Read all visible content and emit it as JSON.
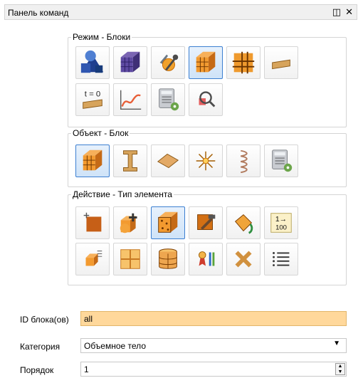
{
  "panel": {
    "title": "Панель команд",
    "float_icon": "float-icon",
    "close_icon": "close-icon"
  },
  "groups": {
    "mode": {
      "title": "Режим - Блоки",
      "buttons": [
        {
          "icon": "geometry-shapes-icon",
          "active": false
        },
        {
          "icon": "mesh-block-icon",
          "active": false
        },
        {
          "icon": "block-tools-icon",
          "active": false
        },
        {
          "icon": "orange-block-icon",
          "active": true
        },
        {
          "icon": "cross-grid-icon",
          "active": false
        },
        {
          "icon": "beam-section-icon",
          "active": false
        },
        {
          "icon": "initial-time-icon",
          "active": false,
          "label": "t = 0"
        },
        {
          "icon": "curve-graph-icon",
          "active": false
        },
        {
          "icon": "calculator-settings-icon",
          "active": false
        },
        {
          "icon": "search-inspect-icon",
          "active": false
        }
      ]
    },
    "object": {
      "title": "Объект - Блок",
      "buttons": [
        {
          "icon": "orange-block-icon",
          "active": true
        },
        {
          "icon": "i-beam-icon",
          "active": false
        },
        {
          "icon": "shell-plate-icon",
          "active": false
        },
        {
          "icon": "point-star-icon",
          "active": false
        },
        {
          "icon": "spring-icon",
          "active": false
        },
        {
          "icon": "calculator-settings-icon",
          "active": false
        }
      ]
    },
    "action": {
      "title": "Действие - Тип элемента",
      "buttons": [
        {
          "icon": "new-block-icon",
          "active": false
        },
        {
          "icon": "add-block-icon",
          "active": false
        },
        {
          "icon": "element-type-block-icon",
          "active": true
        },
        {
          "icon": "hammer-edit-icon",
          "active": false
        },
        {
          "icon": "paint-bucket-icon",
          "active": false
        },
        {
          "icon": "renumber-icon",
          "active": false,
          "label_top": "1→",
          "label_bottom": "100"
        },
        {
          "icon": "small-block-list-icon",
          "active": false
        },
        {
          "icon": "split-block-icon",
          "active": false
        },
        {
          "icon": "cylinder-block-icon",
          "active": false
        },
        {
          "icon": "ribbon-legend-icon",
          "active": false
        },
        {
          "icon": "delete-cross-icon",
          "active": false
        },
        {
          "icon": "list-icon",
          "active": false
        }
      ]
    }
  },
  "form": {
    "block_ids": {
      "label": "ID блока(ов)",
      "value": "all"
    },
    "category": {
      "label": "Категория",
      "value": "Объемное тело"
    },
    "order": {
      "label": "Порядок",
      "value": "1"
    }
  },
  "colors": {
    "highlight": "#ffd89b",
    "active_border": "#3c7fd1"
  }
}
